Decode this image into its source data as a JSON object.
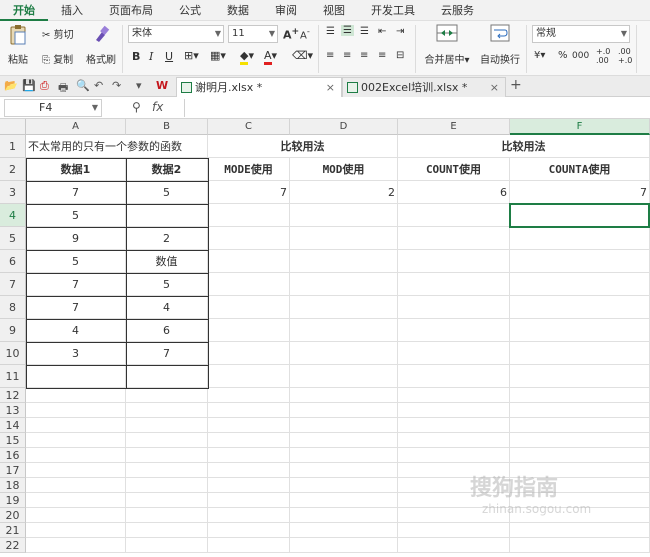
{
  "menu": {
    "items": [
      "开始",
      "插入",
      "页面布局",
      "公式",
      "数据",
      "审阅",
      "视图",
      "开发工具",
      "云服务"
    ]
  },
  "ribbon": {
    "paste": "粘贴",
    "cut": "剪切",
    "copy": "复制",
    "format_painter": "格式刷",
    "font_name": "宋体",
    "font_size": "11",
    "bold": "B",
    "italic": "I",
    "underline": "U",
    "merge_center": "合并居中",
    "wrap_text": "自动换行",
    "number_format": "常规",
    "percent": "%",
    "thousands": "000",
    "inc_decimal": "+.0\n.00",
    "dec_decimal": ".00\n+.0"
  },
  "tabs": [
    {
      "label": "谢明月.xlsx *",
      "active": true
    },
    {
      "label": "002Excel培训.xlsx *",
      "active": false
    }
  ],
  "formula_bar": {
    "name_box": "F4",
    "fx": "fx",
    "formula": ""
  },
  "sheet": {
    "columns": [
      "A",
      "B",
      "C",
      "D",
      "E",
      "F"
    ],
    "rows": [
      "1",
      "2",
      "3",
      "4",
      "5",
      "6",
      "7",
      "8",
      "9",
      "10",
      "11",
      "12",
      "13",
      "14",
      "15",
      "16",
      "17",
      "18",
      "19",
      "20",
      "21",
      "22"
    ],
    "selected_column": "F",
    "selected_row": "4",
    "cells": {
      "A1": "不太常用的只有一个参数的函数",
      "C1": "比较用法",
      "E1": "比较用法",
      "A2": "数据1",
      "B2": "数据2",
      "C2": "MODE使用",
      "D2": "MOD使用",
      "E2": "COUNT使用",
      "F2": "COUNTA使用",
      "A3": "7",
      "B3": "5",
      "C3": "7",
      "D3": "2",
      "E3": "6",
      "F3": "7",
      "A4": "5",
      "A5": "9",
      "B5": "2",
      "A6": "5",
      "B6": "数值",
      "A7": "7",
      "B7": "5",
      "A8": "7",
      "B8": "4",
      "A9": "4",
      "B9": "6",
      "A10": "3",
      "B10": "7"
    }
  },
  "watermark": {
    "text": "搜狗指南",
    "url": "zhinan.sogou.com"
  },
  "colors": {
    "accent": "#1e7d45",
    "header_bg": "#f0f0f0",
    "selected_header_bg": "#d9ecdd"
  }
}
